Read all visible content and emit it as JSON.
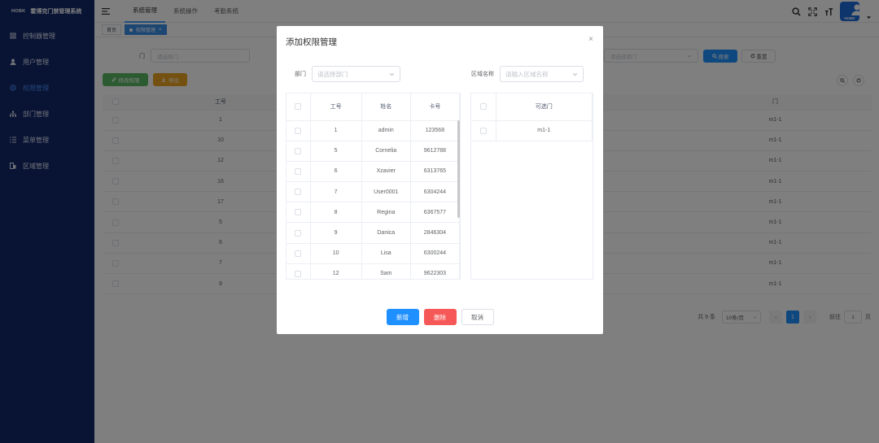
{
  "app": {
    "logo": "HOBK",
    "title": "霍博克门禁管理系统"
  },
  "sidebar": {
    "items": [
      {
        "label": "控制器管理",
        "icon": "controller-icon",
        "active": false
      },
      {
        "label": "用户管理",
        "icon": "user-icon",
        "active": false
      },
      {
        "label": "权限管理",
        "icon": "permission-icon",
        "active": true
      },
      {
        "label": "部门管理",
        "icon": "org-icon",
        "active": false
      },
      {
        "label": "菜单管理",
        "icon": "menu-icon",
        "active": false
      },
      {
        "label": "区域管理",
        "icon": "area-icon",
        "active": false
      }
    ]
  },
  "topnav": {
    "tabs": [
      {
        "label": "系统管理",
        "active": true
      },
      {
        "label": "系统操作",
        "active": false
      },
      {
        "label": "考勤系统",
        "active": false
      }
    ],
    "avatar_text": "HOBK"
  },
  "tags": [
    {
      "label": "首页",
      "active": false
    },
    {
      "label": "权限管理",
      "active": true,
      "close": "×"
    }
  ],
  "search": {
    "door_label": "门",
    "door_placeholder": "请选择门",
    "dept_placeholder": "请选择部门",
    "search_btn": "搜索",
    "reset_btn": "重置"
  },
  "toolbar": {
    "edit_btn": "修改权限",
    "export_btn": "导出"
  },
  "bg_table": {
    "headers": [
      "工号",
      "门"
    ],
    "rows": [
      {
        "id": "1",
        "door": "m1-1",
        "mark": ""
      },
      {
        "id": "10",
        "door": "m1-1",
        "mark": ""
      },
      {
        "id": "12",
        "door": "m1-1",
        "mark": ""
      },
      {
        "id": "16",
        "door": "m1-1",
        "mark": ""
      },
      {
        "id": "17",
        "door": "m1-1",
        "mark": ""
      },
      {
        "id": "5",
        "door": "m1-1",
        "mark": ""
      },
      {
        "id": "6",
        "door": "m1-1",
        "mark": ""
      },
      {
        "id": "7",
        "door": "m1-1",
        "mark": ""
      },
      {
        "id": "9",
        "door": "m1-1",
        "mark": ""
      }
    ]
  },
  "pagination": {
    "total": "共 9 条",
    "page_size": "10条/页",
    "current": "1",
    "goto_label": "前往",
    "goto_value": "1",
    "page_unit": "页"
  },
  "dialog": {
    "title": "添加权限管理",
    "close": "×",
    "dept_label": "部门",
    "dept_placeholder": "请选择部门",
    "area_label": "区域名称",
    "area_placeholder": "请输入区域名称",
    "left_headers": [
      "工号",
      "姓名",
      "卡号"
    ],
    "left_rows": [
      {
        "id": "1",
        "name": "admin",
        "card": "123568"
      },
      {
        "id": "5",
        "name": "Cornelia",
        "card": "9612788"
      },
      {
        "id": "6",
        "name": "Xzavier",
        "card": "6313765"
      },
      {
        "id": "7",
        "name": "User0001",
        "card": "6304244"
      },
      {
        "id": "8",
        "name": "Regina",
        "card": "6367577"
      },
      {
        "id": "9",
        "name": "Danica",
        "card": "2846304"
      },
      {
        "id": "10",
        "name": "Lisa",
        "card": "6300244"
      },
      {
        "id": "12",
        "name": "Sam",
        "card": "9622303"
      }
    ],
    "right_header": "可选门",
    "right_rows": [
      {
        "door": "m1-1"
      }
    ],
    "add_btn": "新增",
    "delete_btn": "删除",
    "cancel_btn": "取消"
  },
  "colors": {
    "sidebar": "#13296b",
    "primary": "#1e90ff",
    "danger": "#f65757",
    "success": "#5ab763",
    "warning": "#e8a321"
  }
}
